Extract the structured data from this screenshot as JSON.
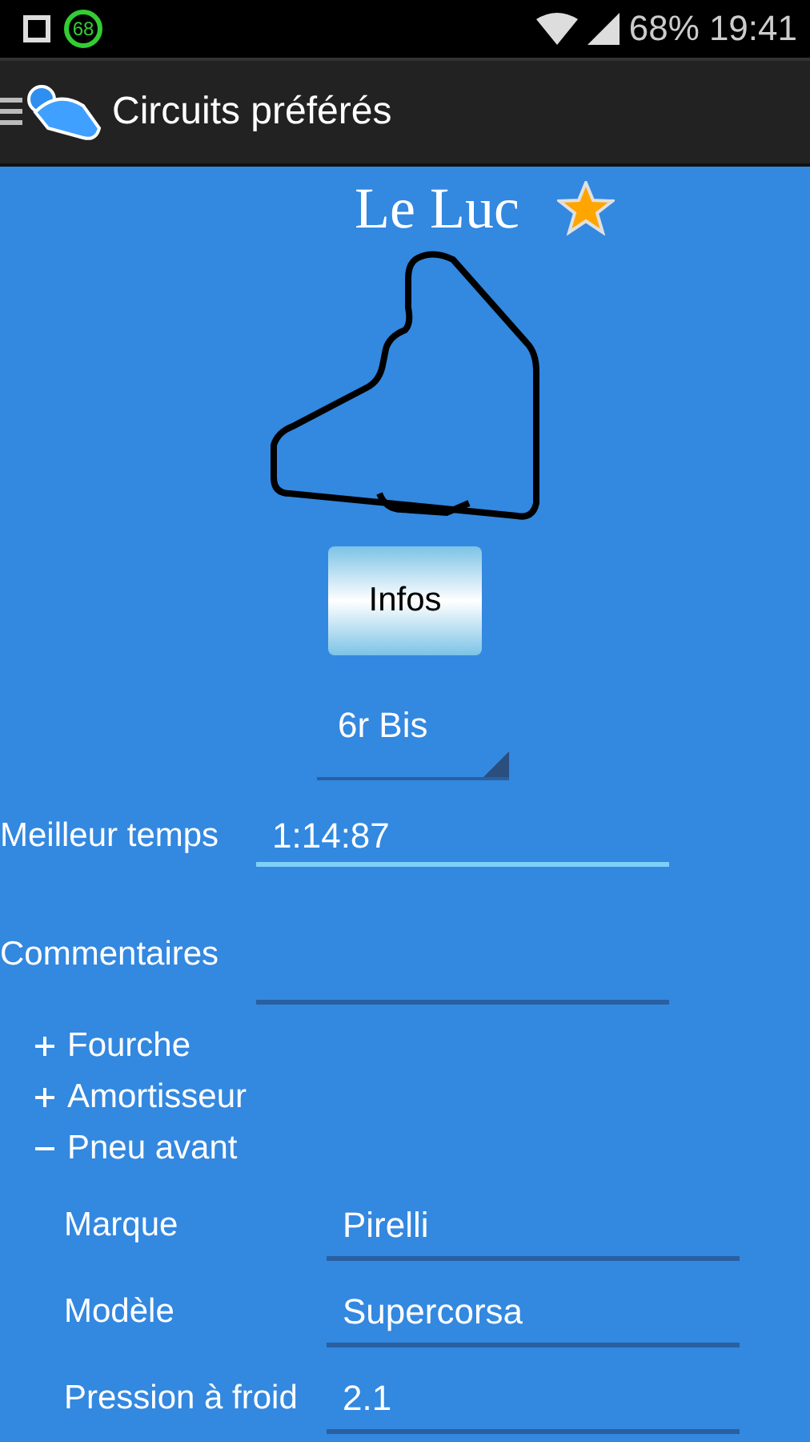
{
  "status_bar": {
    "badge": "68",
    "battery": "68%",
    "time": "19:41"
  },
  "action_bar": {
    "title": "Circuits préférés"
  },
  "circuit": {
    "name": "Le Luc",
    "favorite": true
  },
  "info_button": "Infos",
  "layout_select": {
    "value": "6r Bis"
  },
  "fields": [
    {
      "label": "Meilleur temps",
      "value": "1:14:87",
      "focused": true,
      "kind": "single"
    },
    {
      "label": "Commentaires",
      "focused": false,
      "kind": "multi"
    }
  ],
  "sections": [
    {
      "title": "Fourche",
      "expanded": false
    },
    {
      "title": "Amortisseur",
      "expanded": false
    },
    {
      "title": "Pneu avant",
      "expanded": true,
      "fields": [
        {
          "label": "Marque",
          "value": "Pirelli"
        },
        {
          "label": "Modèle",
          "value": "Supercorsa"
        },
        {
          "label": "Pression à froid",
          "value": "2.1"
        }
      ]
    }
  ]
}
